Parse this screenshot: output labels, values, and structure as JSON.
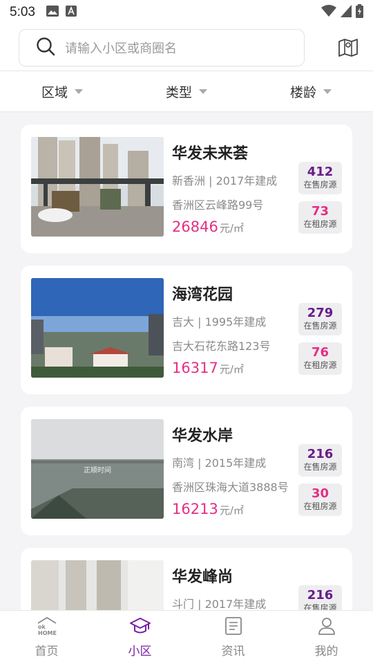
{
  "status": {
    "time": "5:03"
  },
  "search": {
    "placeholder": "请输入小区或商圈名"
  },
  "filters": [
    {
      "label": "区域"
    },
    {
      "label": "类型"
    },
    {
      "label": "楼龄"
    }
  ],
  "communities": [
    {
      "name": "华发未来荟",
      "area": "新香洲 | 2017年建成",
      "address": "香洲区云峰路99号",
      "price": "26846",
      "price_unit": "元/㎡",
      "for_sale": "412",
      "for_sale_label": "在售房源",
      "for_rent": "73",
      "for_rent_label": "在租房源"
    },
    {
      "name": "海湾花园",
      "area": "吉大 | 1995年建成",
      "address": "吉大石花东路123号",
      "price": "16317",
      "price_unit": "元/㎡",
      "for_sale": "279",
      "for_sale_label": "在售房源",
      "for_rent": "76",
      "for_rent_label": "在租房源"
    },
    {
      "name": "华发水岸",
      "area": "南湾 | 2015年建成",
      "address": "香洲区珠海大道3888号",
      "price": "16213",
      "price_unit": "元/㎡",
      "for_sale": "216",
      "for_sale_label": "在售房源",
      "for_rent": "30",
      "for_rent_label": "在租房源",
      "photo_watermark": "正顺时间"
    },
    {
      "name": "华发峰尚",
      "area": "斗门 | 2017年建成",
      "for_sale": "216",
      "for_sale_label": "在售房源"
    }
  ],
  "tabs": [
    {
      "label": "首页",
      "icon": "home-icon",
      "icon_text": "ok\nHOME"
    },
    {
      "label": "小区",
      "icon": "graduation-cap-icon",
      "active": true
    },
    {
      "label": "资讯",
      "icon": "document-icon"
    },
    {
      "label": "我的",
      "icon": "user-icon"
    }
  ],
  "colors": {
    "accent": "#7b1fa2",
    "price": "#e52e85",
    "sale_count": "#6a1b8a"
  }
}
